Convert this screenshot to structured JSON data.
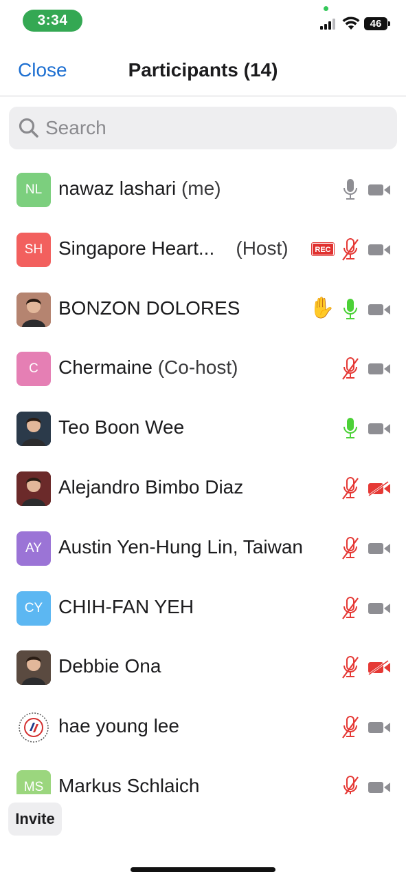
{
  "status_bar": {
    "time": "3:34",
    "battery": "46"
  },
  "header": {
    "close_label": "Close",
    "title": "Participants (14)"
  },
  "search": {
    "placeholder": "Search"
  },
  "participants": [
    {
      "initials": "NL",
      "avatar_color": "#7ccf7e",
      "photo": false,
      "name": "nawaz lashari",
      "role": "(me)",
      "mic": "available",
      "video": "off-gray",
      "hand": false,
      "rec": false
    },
    {
      "initials": "SH",
      "avatar_color": "#f2605e",
      "photo": false,
      "name": "Singapore Heart...",
      "role": "(Host)",
      "mic": "muted",
      "video": "off-gray",
      "hand": false,
      "rec": true,
      "rec_label": "REC"
    },
    {
      "initials": "",
      "avatar_color": "#b58470",
      "photo": true,
      "name": "BONZON DOLORES",
      "role": "",
      "mic": "speaking",
      "video": "off-gray",
      "hand": true,
      "hand_icon": "✋",
      "rec": false
    },
    {
      "initials": "C",
      "avatar_color": "#e57fb4",
      "photo": false,
      "name": "Chermaine",
      "role": "(Co-host)",
      "mic": "muted",
      "video": "off-gray",
      "hand": false,
      "rec": false
    },
    {
      "initials": "",
      "avatar_color": "#2b3a4a",
      "photo": true,
      "name": "Teo Boon Wee",
      "role": "",
      "mic": "speaking",
      "video": "off-gray",
      "hand": false,
      "rec": false
    },
    {
      "initials": "",
      "avatar_color": "#6b2a2a",
      "photo": true,
      "name": "Alejandro Bimbo Diaz",
      "role": "",
      "mic": "muted",
      "video": "stopped",
      "hand": false,
      "rec": false
    },
    {
      "initials": "AY",
      "avatar_color": "#9b74d6",
      "photo": false,
      "name": "Austin Yen-Hung Lin, Taiwan",
      "role": "",
      "mic": "muted",
      "video": "off-gray",
      "hand": false,
      "rec": false
    },
    {
      "initials": "CY",
      "avatar_color": "#5cb7f2",
      "photo": false,
      "name": "CHIH-FAN YEH",
      "role": "",
      "mic": "muted",
      "video": "off-gray",
      "hand": false,
      "rec": false
    },
    {
      "initials": "",
      "avatar_color": "#5a4a40",
      "photo": true,
      "name": "Debbie Ona",
      "role": "",
      "mic": "muted",
      "video": "stopped",
      "hand": false,
      "rec": false
    },
    {
      "initials": "",
      "avatar_color": "#ffffff",
      "photo": true,
      "name": "hae young lee",
      "role": "",
      "mic": "muted",
      "video": "off-gray",
      "hand": false,
      "rec": false
    },
    {
      "initials": "MS",
      "avatar_color": "#9bd67e",
      "photo": false,
      "name": "Markus Schlaich",
      "role": "",
      "mic": "muted",
      "video": "off-gray",
      "hand": false,
      "rec": false
    }
  ],
  "footer": {
    "invite_label": "Invite"
  },
  "colors": {
    "accent": "#1d6fd1",
    "muted_red": "#e53935",
    "speaking_green": "#4cd137",
    "icon_gray": "#8e8e93"
  }
}
